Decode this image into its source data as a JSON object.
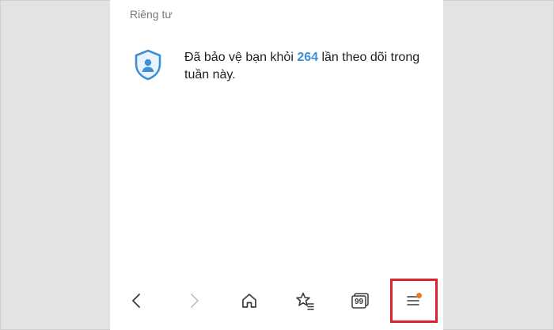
{
  "privacy": {
    "section_title": "Riêng tư",
    "message_prefix": "Đã bảo vệ bạn khỏi ",
    "tracker_count": "264",
    "message_suffix": " lần theo dõi trong tuần này."
  },
  "bottom_nav": {
    "items": [
      {
        "name": "back-button",
        "icon": "chevron-left-icon"
      },
      {
        "name": "forward-button",
        "icon": "chevron-right-icon",
        "disabled": true
      },
      {
        "name": "home-button",
        "icon": "home-icon"
      },
      {
        "name": "bookmarks-button",
        "icon": "star-list-icon"
      },
      {
        "name": "tabs-button",
        "icon": "tabs-icon",
        "label": "99"
      },
      {
        "name": "menu-button",
        "icon": "hamburger-icon",
        "has_notification": true,
        "highlighted": true
      }
    ]
  },
  "colors": {
    "accent": "#3d8fd6",
    "highlight_border": "#e0202a",
    "notification_dot": "#ee7a22"
  }
}
